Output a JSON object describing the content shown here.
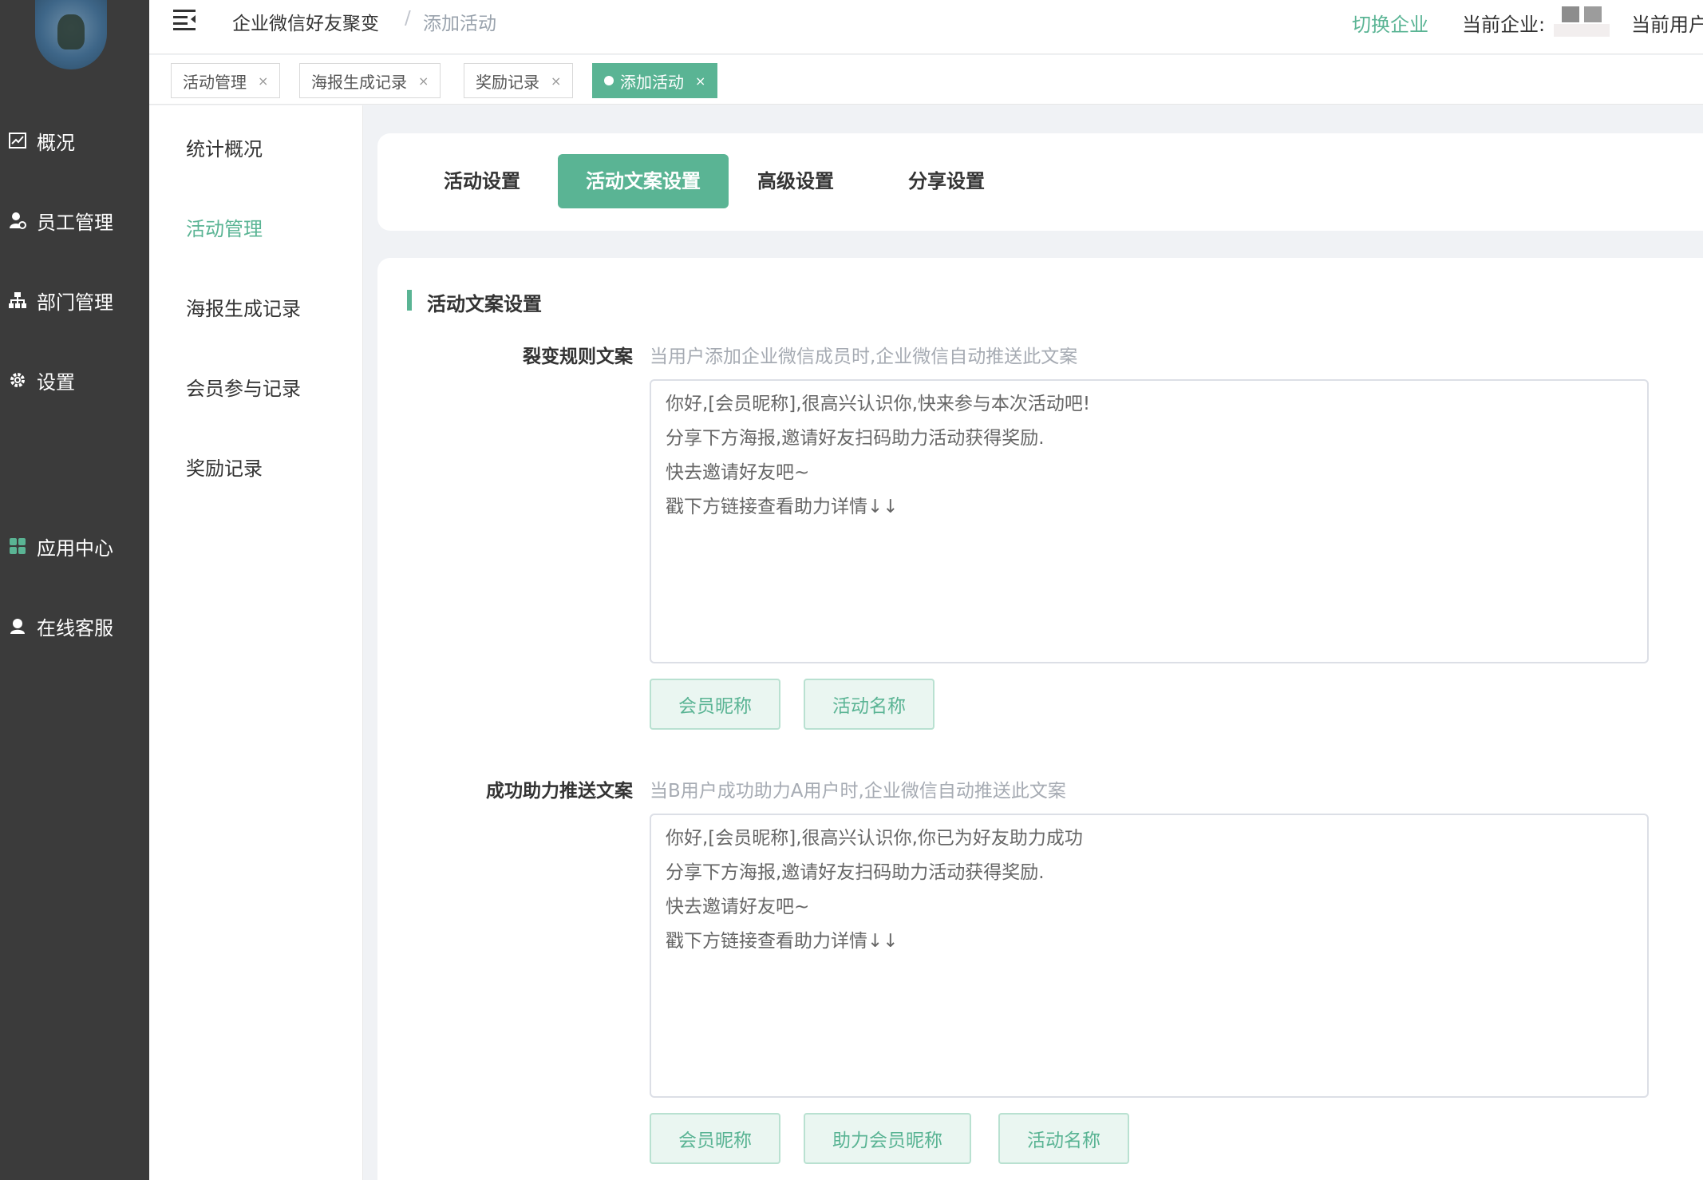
{
  "sidebar": {
    "items": [
      {
        "label": "概况",
        "icon": "chart-icon"
      },
      {
        "label": "员工管理",
        "icon": "user-gear-icon"
      },
      {
        "label": "部门管理",
        "icon": "org-icon"
      },
      {
        "label": "设置",
        "icon": "gear-icon"
      },
      {
        "label": "应用中心",
        "icon": "apps-icon"
      },
      {
        "label": "在线客服",
        "icon": "support-icon"
      }
    ]
  },
  "header": {
    "breadcrumb_root": "企业微信好友聚变",
    "breadcrumb_sep": "/",
    "breadcrumb_current": "添加活动",
    "switch_label": "切换企业",
    "current_enterprise_label": "当前企业:",
    "current_user_label": "当前用户:"
  },
  "tabs": [
    {
      "label": "活动管理",
      "active": false
    },
    {
      "label": "海报生成记录",
      "active": false
    },
    {
      "label": "奖励记录",
      "active": false
    },
    {
      "label": "添加活动",
      "active": true
    }
  ],
  "submenu": {
    "items": [
      {
        "label": "统计概况",
        "active": false
      },
      {
        "label": "活动管理",
        "active": true
      },
      {
        "label": "海报生成记录",
        "active": false
      },
      {
        "label": "会员参与记录",
        "active": false
      },
      {
        "label": "奖励记录",
        "active": false
      }
    ]
  },
  "steps": [
    {
      "label": "活动设置",
      "active": false
    },
    {
      "label": "活动文案设置",
      "active": true
    },
    {
      "label": "高级设置",
      "active": false
    },
    {
      "label": "分享设置",
      "active": false
    }
  ],
  "form": {
    "section_title": "活动文案设置",
    "fission": {
      "label": "裂变规则文案",
      "hint": "当用户添加企业微信成员时,企业微信自动推送此文案",
      "lines": [
        "你好,[会员昵称],很高兴认识你,快来参与本次活动吧!",
        "分享下方海报,邀请好友扫码助力活动获得奖励.",
        "快去邀请好友吧~",
        "戳下方链接查看助力详情↓↓"
      ],
      "buttons": [
        "会员昵称",
        "活动名称"
      ]
    },
    "success": {
      "label": "成功助力推送文案",
      "hint": "当B用户成功助力A用户时,企业微信自动推送此文案",
      "lines": [
        "你好,[会员昵称],很高兴认识你,你已为好友助力成功",
        "分享下方海报,邀请好友扫码助力活动获得奖励.",
        "快去邀请好友吧~",
        "戳下方链接查看助力详情↓↓"
      ],
      "buttons": [
        "会员昵称",
        "助力会员昵称",
        "活动名称"
      ]
    }
  },
  "colors": {
    "accent": "#5ab494",
    "sidebar_bg": "#3b3b3b"
  }
}
